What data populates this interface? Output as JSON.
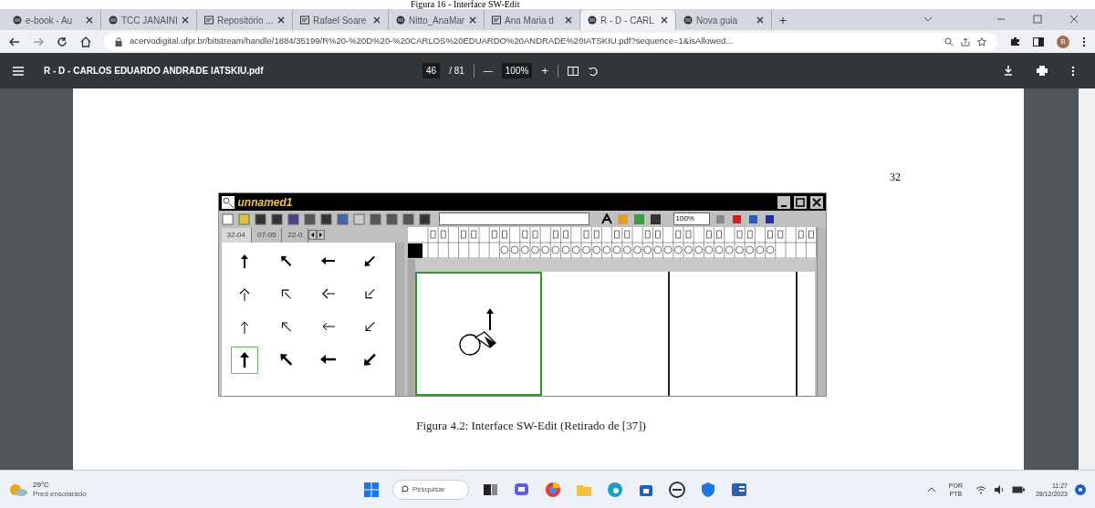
{
  "document_caption": "Figura 16 - Interface SW-Edit",
  "browser": {
    "tabs": [
      {
        "label": "e-book - Au",
        "kind": "web",
        "selected": false
      },
      {
        "label": "TCC JANAINI",
        "kind": "web",
        "selected": false
      },
      {
        "label": "Repositório ...",
        "kind": "document",
        "selected": false
      },
      {
        "label": "Rafael Soare",
        "kind": "document",
        "selected": false
      },
      {
        "label": "Nitto_AnaMar",
        "kind": "web",
        "selected": false
      },
      {
        "label": "Ana Maria d",
        "kind": "document",
        "selected": false
      },
      {
        "label": "R - D - CARL",
        "kind": "web",
        "selected": true
      },
      {
        "label": "Nova guia",
        "kind": "web",
        "selected": false
      }
    ],
    "new_tab": "+",
    "url": "acervodigital.ufpr.br/bitstream/handle/1884/35199/R%20-%20D%20-%20CARLOS%20EDUARDO%20ANDRADE%20IATSKIU.pdf?sequence=1&isAllowed...",
    "profile_initial": "B"
  },
  "pdf_toolbar": {
    "file_name": "R - D - CARLOS EDUARDO ANDRADE IATSKIU.pdf",
    "page": "46",
    "page_total": "/ 81",
    "zoom_out": "—",
    "zoom": "100%",
    "zoom_in": "+"
  },
  "pdf_page": {
    "page_number": "32",
    "figure": {
      "window_title": "unnamed1",
      "zoom_field": "100%",
      "panel_tabs": [
        {
          "label": "32-04",
          "selected": true
        },
        {
          "label": "07-05",
          "selected": false
        },
        {
          "label": "22-0",
          "selected": false
        }
      ],
      "symbols": [
        {
          "kind": "solid",
          "selected": false
        },
        {
          "kind": "solid",
          "selected": false
        },
        {
          "kind": "solid",
          "selected": false
        },
        {
          "kind": "solid",
          "selected": false
        },
        {
          "kind": "hollow",
          "selected": false
        },
        {
          "kind": "hollow",
          "selected": false
        },
        {
          "kind": "hollow",
          "selected": false
        },
        {
          "kind": "hollow",
          "selected": false
        },
        {
          "kind": "thin",
          "selected": false
        },
        {
          "kind": "thin",
          "selected": false
        },
        {
          "kind": "thin",
          "selected": false
        },
        {
          "kind": "thin",
          "selected": false
        },
        {
          "kind": "bold",
          "selected": true
        },
        {
          "kind": "bold",
          "selected": false
        },
        {
          "kind": "bold",
          "selected": false
        },
        {
          "kind": "bold",
          "selected": false
        }
      ],
      "canvas_cells": [
        {
          "kind": "sign",
          "selected": true
        },
        {
          "kind": "empty",
          "selected": false
        },
        {
          "kind": "empty",
          "selected": false
        }
      ]
    },
    "caption": "Figura 4.2: Interface SW-Edit (Retirado de [37])"
  },
  "taskbar": {
    "temperature": "29°C",
    "weather": "Pred ensolarado",
    "search_placeholder": "Pesquisar",
    "language": "POR",
    "layout": "PTB",
    "time": "11:27",
    "date": "28/12/2023"
  }
}
